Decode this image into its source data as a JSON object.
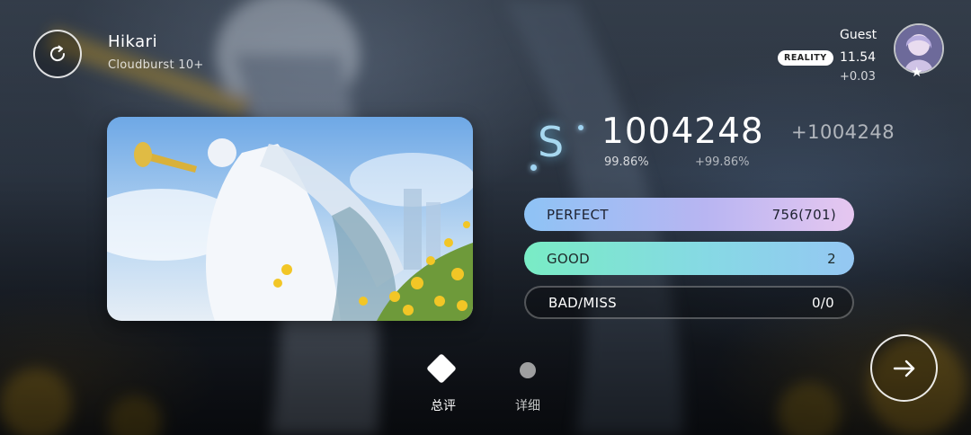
{
  "song": {
    "title": "Hikari",
    "difficulty": "Cloudburst 10+"
  },
  "player": {
    "name": "Guest",
    "badge": "REALITY",
    "rks": "11.54",
    "rks_delta": "+0.03"
  },
  "result": {
    "rank": "S",
    "score": "1004248",
    "score_delta": "+1004248",
    "accuracy": "99.86%",
    "accuracy_delta": "+99.86%"
  },
  "judgements": [
    {
      "label": "PERFECT",
      "value": "756(701)"
    },
    {
      "label": "GOOD",
      "value": "2"
    },
    {
      "label": "BAD/MISS",
      "value": "0/0"
    }
  ],
  "tabs": {
    "summary_label": "总评",
    "detail_label": "详细"
  },
  "icons": {
    "retry": "retry-icon",
    "next": "arrow-right-icon",
    "star": "star-icon"
  },
  "colors": {
    "perfect_gradient_start": "#8ec3f5",
    "perfect_gradient_end": "#e6c7f0",
    "good_gradient_start": "#79ecc5",
    "good_gradient_end": "#95c7f3",
    "rank_color": "#a7d8f0"
  }
}
